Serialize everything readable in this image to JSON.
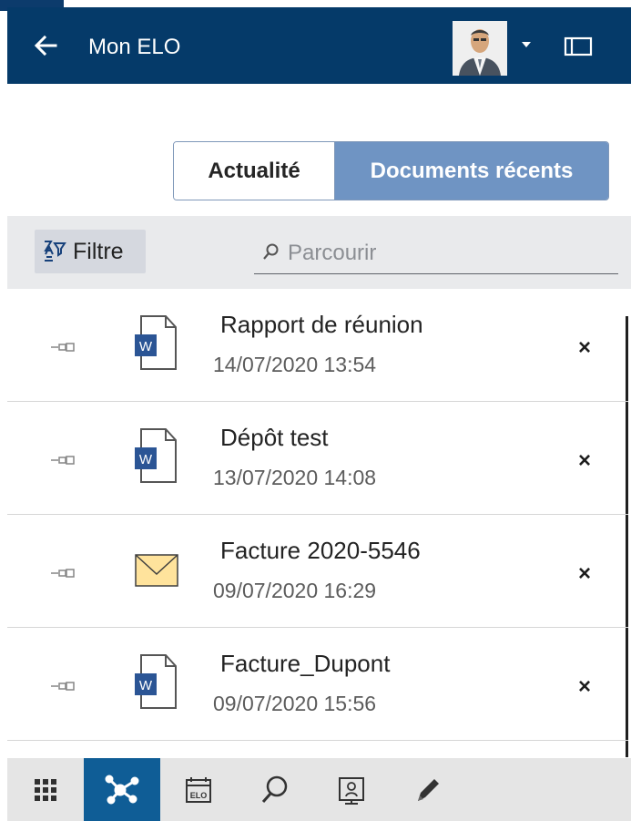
{
  "header": {
    "title": "Mon ELO",
    "back_icon": "arrow-left-icon",
    "profile_icon": "user-avatar-icon",
    "caret_icon": "caret-down-icon",
    "panel_icon": "panel-toggle-icon"
  },
  "tabs": {
    "left": "Actualité",
    "right": "Documents récents"
  },
  "toolbar": {
    "filter_label": "Filtre",
    "filter_icon": "filter-icon",
    "search_placeholder": "Parcourir",
    "search_icon": "search-icon"
  },
  "documents": [
    {
      "title": "Rapport de réunion",
      "date": "14/07/2020 13:54",
      "icon": "word-document-icon"
    },
    {
      "title": "Dépôt test",
      "date": "13/07/2020 14:08",
      "icon": "word-document-icon"
    },
    {
      "title": "Facture 2020-5546",
      "date": "09/07/2020 16:29",
      "icon": "email-icon"
    },
    {
      "title": "Facture_Dupont",
      "date": "09/07/2020 15:56",
      "icon": "word-document-icon"
    }
  ],
  "bottom_nav": [
    {
      "icon": "app-grid-icon"
    },
    {
      "icon": "network-icon",
      "active": true
    },
    {
      "icon": "elo-calendar-icon"
    },
    {
      "icon": "search-icon"
    },
    {
      "icon": "presentation-user-icon"
    },
    {
      "icon": "pencil-icon"
    }
  ],
  "colors": {
    "header_bg": "#053a69",
    "accent": "#6f94c3",
    "active_nav": "#0f5d96"
  }
}
